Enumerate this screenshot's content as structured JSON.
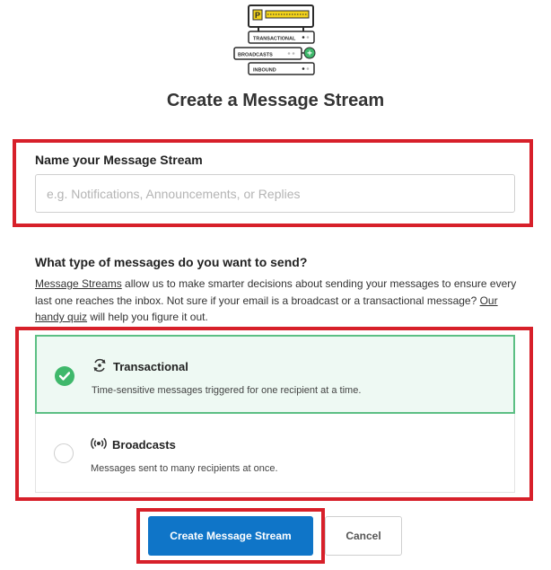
{
  "illustration": {
    "logo_letter": "P",
    "streams": [
      "TRANSACTIONAL",
      "BROADCASTS",
      "INBOUND"
    ],
    "add_symbol": "+"
  },
  "page_title": "Create a Message Stream",
  "name_section": {
    "label": "Name your Message Stream",
    "input_value": "",
    "placeholder": "e.g. Notifications, Announcements, or Replies"
  },
  "type_section": {
    "label": "What type of messages do you want to send?",
    "desc_link1": "Message Streams",
    "desc_text1": " allow us to make smarter decisions about sending your messages to ensure every last one reaches the inbox. Not sure if your email is a broadcast or a transactional message? ",
    "desc_link2": "Our handy quiz",
    "desc_text2": " will help you figure it out.",
    "options": [
      {
        "title": "Transactional",
        "description": "Time-sensitive messages triggered for one recipient at a time.",
        "selected": true,
        "icon": "transactional-icon"
      },
      {
        "title": "Broadcasts",
        "description": "Messages sent to many recipients at once.",
        "selected": false,
        "icon": "broadcast-icon"
      }
    ]
  },
  "actions": {
    "create_label": "Create Message Stream",
    "cancel_label": "Cancel"
  },
  "colors": {
    "accent": "#0f75c8",
    "selected_border": "#5cbf84",
    "selected_bg": "#eef9f3",
    "check": "#3fb86b",
    "highlight": "#d7202a"
  }
}
